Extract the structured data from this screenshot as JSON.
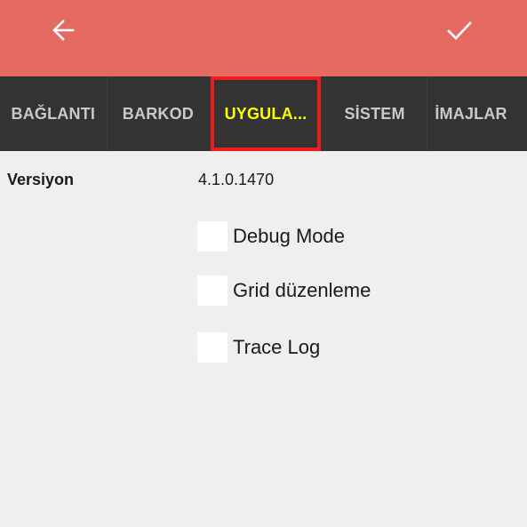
{
  "header": {
    "back_icon": "arrow-left-icon",
    "confirm_icon": "check-icon",
    "bar_color": "#e46a62"
  },
  "tabs": [
    {
      "label": "BAĞLANTI",
      "active": false
    },
    {
      "label": "BARKOD",
      "active": false
    },
    {
      "label": "UYGULA...",
      "active": true
    },
    {
      "label": "SİSTEM",
      "active": false
    },
    {
      "label": "İMAJLAR",
      "active": false
    }
  ],
  "colors": {
    "tab_bar": "#333333",
    "active_tab_text": "#ffff00",
    "highlight_border": "#ee1c1c"
  },
  "content": {
    "version_label": "Versiyon",
    "version_value": "4.1.0.1470",
    "options": [
      {
        "label": "Debug Mode",
        "checked": false
      },
      {
        "label": "Grid düzenleme",
        "checked": false
      },
      {
        "label": "Trace Log",
        "checked": false
      }
    ]
  }
}
